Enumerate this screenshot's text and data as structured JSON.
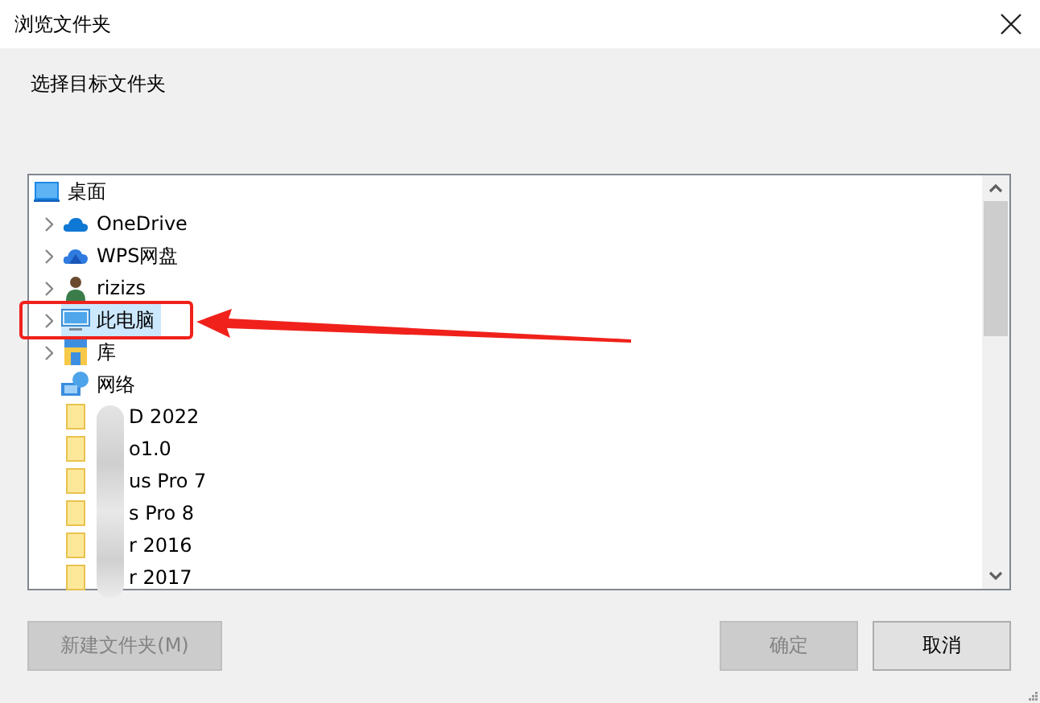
{
  "window": {
    "title": "浏览文件夹"
  },
  "prompt": "选择目标文件夹",
  "tree": {
    "label": "桌面",
    "kind": "desktop",
    "children": [
      {
        "label": "OneDrive",
        "kind": "cloud",
        "expandable": true,
        "selected": false
      },
      {
        "label": "WPS网盘",
        "kind": "cloud2",
        "expandable": true,
        "selected": false
      },
      {
        "label": "rizizs",
        "kind": "user",
        "expandable": true,
        "selected": false
      },
      {
        "label": "此电脑",
        "kind": "pc",
        "expandable": true,
        "selected": true
      },
      {
        "label": "库",
        "kind": "library",
        "expandable": true,
        "selected": false
      },
      {
        "label": "网络",
        "kind": "network",
        "expandable": false,
        "selected": false
      },
      {
        "label": "D 2022",
        "kind": "folder",
        "expandable": false,
        "selected": false
      },
      {
        "label": "o1.0",
        "kind": "folder",
        "expandable": false,
        "selected": false
      },
      {
        "label": "us Pro 7",
        "kind": "folder",
        "expandable": false,
        "selected": false
      },
      {
        "label": "s Pro 8",
        "kind": "folder",
        "expandable": false,
        "selected": false
      },
      {
        "label": "r 2016",
        "kind": "folder",
        "expandable": false,
        "selected": false
      },
      {
        "label": "r 2017",
        "kind": "folder",
        "expandable": false,
        "selected": false
      }
    ]
  },
  "buttons": [
    {
      "label": "新建文件夹(M)",
      "disabled": true
    },
    {
      "label": "确定",
      "disabled": true
    },
    {
      "label": "取消",
      "disabled": false
    }
  ]
}
